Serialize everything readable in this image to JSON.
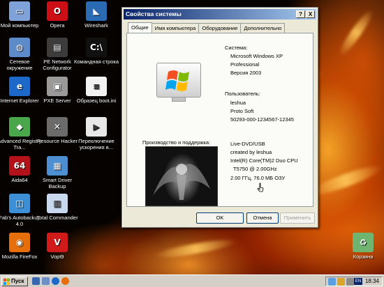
{
  "desktop": {
    "icons": [
      {
        "label": "Мой компьютер",
        "icon": "my-computer-icon",
        "color": "#7fa3d8",
        "glyph": "▭"
      },
      {
        "label": "Opera",
        "icon": "opera-icon",
        "color": "#cc0f16",
        "glyph": "O"
      },
      {
        "label": "Wireshark",
        "icon": "wireshark-icon",
        "color": "#2a6bb3",
        "glyph": "◣"
      },
      {
        "label": "Сетевое окружение",
        "icon": "network-places-icon",
        "color": "#5d8ac9",
        "glyph": "◍"
      },
      {
        "label": "PE Network Configurator",
        "icon": "network-configurator-icon",
        "color": "#3c3c3c",
        "glyph": "▤"
      },
      {
        "label": "Командная строка",
        "icon": "command-prompt-icon",
        "color": "#111111",
        "glyph": "C:\\"
      },
      {
        "label": "Internet Explorer",
        "icon": "internet-explorer-icon",
        "color": "#1d69c9",
        "glyph": "e"
      },
      {
        "label": "PXE Server",
        "icon": "pxe-server-icon",
        "color": "#9a9a9a",
        "glyph": "▣"
      },
      {
        "label": "Образец boot.ini",
        "icon": "text-file-icon",
        "color": "#f2f2f2",
        "glyph": "≡"
      },
      {
        "label": "Advanced Registry Tra...",
        "icon": "registry-tracer-icon",
        "color": "#4aa64a",
        "glyph": "◆"
      },
      {
        "label": "Resource Hacker",
        "icon": "resource-hacker-icon",
        "color": "#6b6b6b",
        "glyph": "✕"
      },
      {
        "label": "Переключение ускорения в...",
        "icon": "acceleration-switch-icon",
        "color": "#e8e8e8",
        "glyph": "▶"
      },
      {
        "label": "Aida64",
        "icon": "aida64-icon",
        "color": "#b3121b",
        "glyph": "64"
      },
      {
        "label": "Smart Driver Backup",
        "icon": "smart-driver-backup-icon",
        "color": "#4d8fd0",
        "glyph": "▦"
      },
      {
        "label": "Fab's Autobackup 4.0",
        "icon": "autobackup-icon",
        "color": "#3d8fd6",
        "glyph": "◫"
      },
      {
        "label": "Total Commander",
        "icon": "total-commander-icon",
        "color": "#c8d8ee",
        "glyph": "▥"
      },
      {
        "label": "Mozilla FireFox",
        "icon": "firefox-icon",
        "color": "#e66f0c",
        "glyph": "◉"
      },
      {
        "label": "Vopt9",
        "icon": "vopt9-icon",
        "color": "#d11a1a",
        "glyph": "V"
      },
      {
        "label": "Корзина",
        "icon": "recycle-bin-icon",
        "color": "#6fb56f",
        "glyph": "♻"
      }
    ]
  },
  "dialog": {
    "title": "Свойства системы",
    "help_button": "?",
    "close_button": "X",
    "tabs": [
      "Общие",
      "Имя компьютера",
      "Оборудование",
      "Дополнительно"
    ],
    "system": {
      "heading": "Система:",
      "lines": [
        "Microsoft Windows XP",
        "Professional",
        "Версия 2003"
      ]
    },
    "user": {
      "heading": "Пользователь:",
      "lines": [
        "leshua",
        "Proto Soft",
        "50293-000-1234567-12345"
      ]
    },
    "oem": {
      "heading": "Производство и поддержка:",
      "lines": [
        "Live-DVD/USB",
        "created by leshua",
        "Intel(R) Core(TM)2 Duo CPU",
        "T5750 @ 2.00GHz",
        "2.00 ГГц, 76.0 МБ ОЗУ"
      ]
    },
    "buttons": {
      "ok": "OK",
      "cancel": "Отмена",
      "apply": "Применить"
    }
  },
  "taskbar": {
    "start_label": "Пуск",
    "language": "EN",
    "clock": "18:34"
  }
}
